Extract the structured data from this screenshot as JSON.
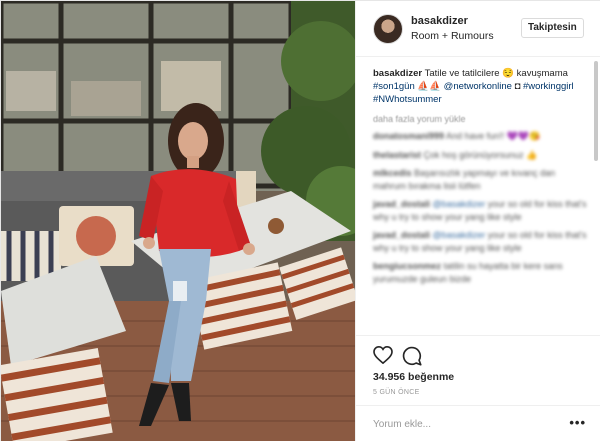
{
  "post": {
    "username": "basakdizer",
    "location": "Room + Rumours",
    "follow_label": "Takiptesin"
  },
  "caption": {
    "user": "basakdizer",
    "text_1": "Tatile ve tatilcilere 😌 kavuşmama ",
    "tag_1": "#son1gün",
    "text_2": " ⛵⛵",
    "mention": "@networkonline",
    "text_3": " ◘ ",
    "tag_2": "#workinggirl",
    "tag_3": "#NWhotsummer"
  },
  "load_more": "daha fazla yorum yükle",
  "comments": [
    {
      "user": "donatosmani999",
      "text": "And have fun!! 💜💜😘"
    },
    {
      "user": "thelastarist",
      "text": "Çok hoş görünüyorsunuz 👍"
    },
    {
      "user": "mlkcedis",
      "text": "Başarısızlık yapmayı ve kıvanç dan mahrum bırakma lisii lütfen"
    },
    {
      "user": "javad_dostali",
      "mention": "@basakdizer",
      "text": "your so old for kiss that's why u try to show your yang like style"
    },
    {
      "user": "javad_dostali",
      "mention": "@basakdizer",
      "text": "your so old for kiss that's why u try to show your yang like style"
    },
    {
      "user": "bengiucsonmez",
      "text": "tatilin su hayatta bir kere sans yurumuzde guleun bizde"
    }
  ],
  "actions": {
    "likes": "34.956 beğenme",
    "time": "5 GÜN ÖNCE",
    "heart_icon": "heart-icon",
    "comment_icon": "comment-bubble-icon"
  },
  "add_comment": {
    "placeholder": "Yorum ekle...",
    "more_label": "•••"
  }
}
